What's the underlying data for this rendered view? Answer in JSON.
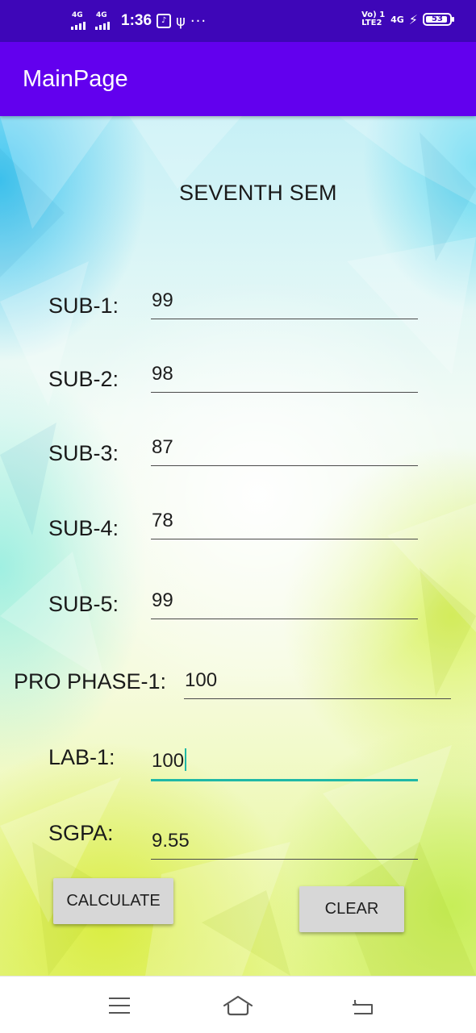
{
  "status_bar": {
    "signal_1_label": "4G",
    "signal_2_label": "4G",
    "time": "1:36",
    "volte_label": "Vo) 1 LTE2",
    "network_label": "4G",
    "battery_level": "53"
  },
  "app_bar": {
    "title": "MainPage"
  },
  "form": {
    "title": "SEVENTH SEM",
    "rows": [
      {
        "label": "SUB-1:",
        "value": "99"
      },
      {
        "label": "SUB-2:",
        "value": "98"
      },
      {
        "label": "SUB-3:",
        "value": "87"
      },
      {
        "label": "SUB-4:",
        "value": "78"
      },
      {
        "label": "SUB-5:",
        "value": "99"
      },
      {
        "label": "PRO PHASE-1:",
        "value": "100"
      },
      {
        "label": "LAB-1:",
        "value": "100"
      },
      {
        "label": "SGPA:",
        "value": "9.55"
      }
    ],
    "focused_field": "LAB-1:",
    "accent_color": "#1fb8a6"
  },
  "buttons": {
    "calculate": "CALCULATE",
    "clear": "CLEAR"
  },
  "navigation": {
    "menu_icon": "menu-icon",
    "home_icon": "home-icon",
    "back_icon": "back-icon"
  },
  "colors": {
    "status_bar": "#3e06b8",
    "app_bar": "#6200ee",
    "button": "#d7d7d7"
  }
}
